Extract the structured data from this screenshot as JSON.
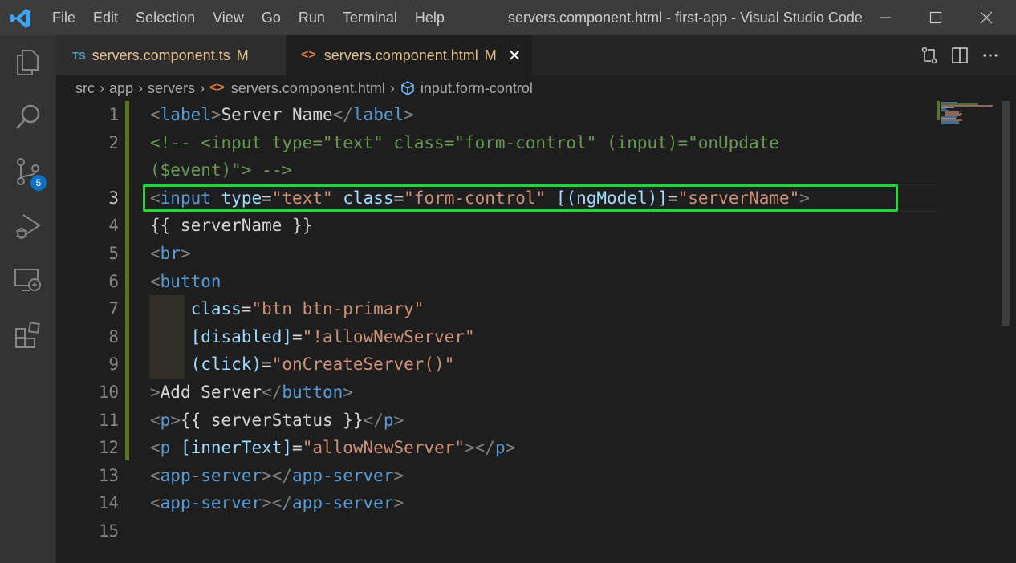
{
  "titlebar": {
    "menu": [
      "File",
      "Edit",
      "Selection",
      "View",
      "Go",
      "Run",
      "Terminal",
      "Help"
    ],
    "window_title": "servers.component.html - first-app - Visual Studio Code"
  },
  "activity_bar": {
    "items": [
      "explorer-icon",
      "search-icon",
      "source-control-icon",
      "run-debug-icon",
      "remote-explorer-icon",
      "extensions-icon"
    ],
    "source_control_badge": "5"
  },
  "tabs": [
    {
      "icon": "TS",
      "label": "servers.component.ts",
      "status": "M",
      "active": false
    },
    {
      "icon": "<>",
      "label": "servers.component.html",
      "status": "M",
      "active": true,
      "close": "✕"
    }
  ],
  "breadcrumb": {
    "parts": [
      "src",
      "app",
      "servers",
      "servers.component.html",
      "input.form-control"
    ]
  },
  "editor": {
    "line_numbers": [
      "1",
      "2",
      "",
      "3",
      "4",
      "5",
      "6",
      "7",
      "8",
      "9",
      "10",
      "11",
      "12",
      "13",
      "14",
      "15"
    ],
    "active_line": "3",
    "colors": {
      "tag": "#569cd6",
      "attr": "#9cdcfe",
      "string": "#ce9178",
      "comment": "#6a9955",
      "text": "#d4d4d4",
      "highlight_box": "#22d63a",
      "modified_gutter": "#587c0c"
    }
  }
}
